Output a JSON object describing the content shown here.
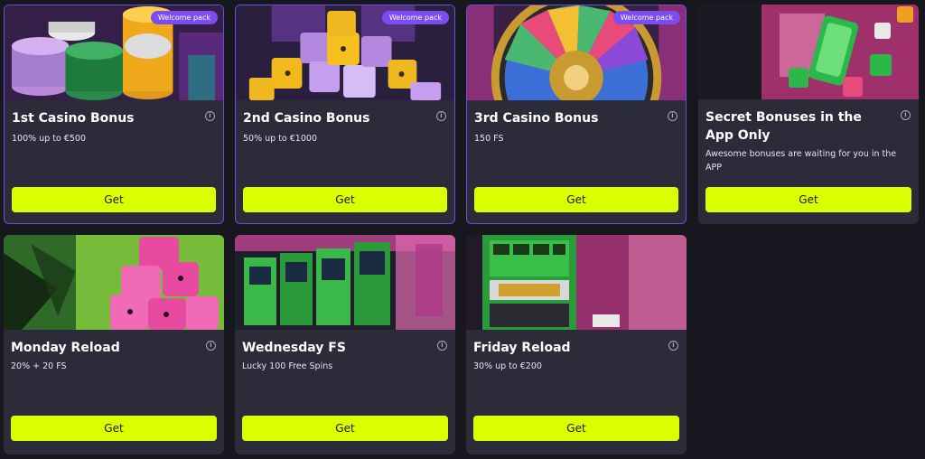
{
  "cards": [
    {
      "title": "1st Casino Bonus",
      "desc": "100% up to €500",
      "badge": "Welcome pack",
      "button": "Get"
    },
    {
      "title": "2nd Casino Bonus",
      "desc": "50% up to €1000",
      "badge": "Welcome pack",
      "button": "Get"
    },
    {
      "title": "3rd Casino Bonus",
      "desc": "150 FS",
      "badge": "Welcome pack",
      "button": "Get"
    },
    {
      "title": "Secret Bonuses in the App Only",
      "desc": "Awesome bonuses are waiting for you in the APP",
      "button": "Get"
    },
    {
      "title": "Monday Reload",
      "desc": "20% + 20 FS",
      "button": "Get"
    },
    {
      "title": "Wednesday FS",
      "desc": "Lucky 100 Free Spins",
      "button": "Get"
    },
    {
      "title": "Friday Reload",
      "desc": "30% up to €200",
      "button": "Get"
    }
  ],
  "info_icon": "info-icon",
  "colors": {
    "accent": "#d9ff00",
    "badge": "#7b4df0",
    "card": "#2b2b3a",
    "background": "#17171f"
  }
}
